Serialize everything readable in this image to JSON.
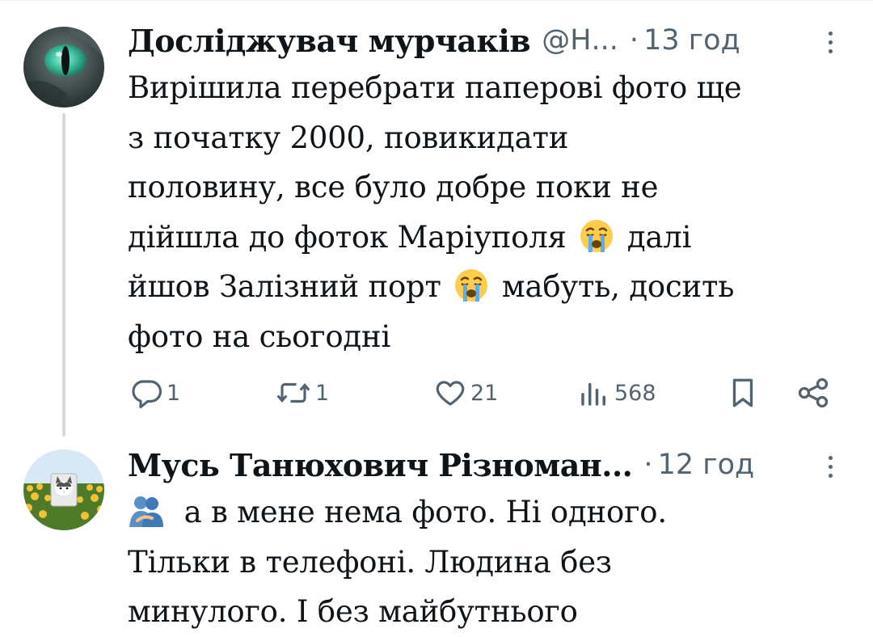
{
  "reply1": {
    "author_name": "Досліджувач мурчаків",
    "handle": "@Н...",
    "separator": "·",
    "time": "13 год",
    "text_lines": [
      "Вирішила перебрати паперові фото ще",
      "з початку 2000, повикидати",
      "половину, все було добре поки не",
      "дійшла до фоток Маріуполя",
      "йшов Залізний порт"
    ],
    "line4_tail": "далі",
    "line5_tail": "мабуть, досить",
    "last_line": "фото на сьогодні",
    "emoji": "loudly-crying-face",
    "stats": {
      "replies": "1",
      "reposts": "1",
      "likes": "21",
      "views": "568"
    }
  },
  "reply2": {
    "author_name": "Мусь Танюхович Різноман...",
    "separator": "·",
    "time": "12 год",
    "emoji": "people-hugging",
    "text_lines": [
      "а в мене нема фото. Ні одного.",
      "Тільки в телефоні. Людина без",
      "минулого. І без майбутнього"
    ]
  },
  "colors": {
    "text": "#0f1419",
    "secondary": "#536471",
    "thread_line": "#cfd9de"
  }
}
